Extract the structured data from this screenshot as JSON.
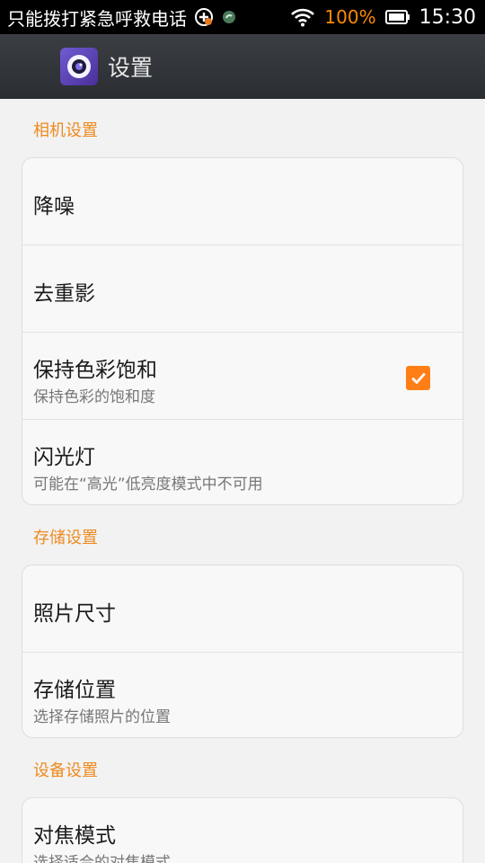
{
  "status_bar": {
    "carrier_text": "只能拨打紧急呼救电话",
    "battery_percent": "100%",
    "time": "15:30",
    "icons": [
      "emergency-plus-icon",
      "app-notification-icon",
      "wifi-icon",
      "battery-icon"
    ]
  },
  "app_bar": {
    "title": "设置",
    "icon": "camera-app-icon"
  },
  "sections": [
    {
      "title": "相机设置",
      "items": [
        {
          "title": "降噪",
          "subtitle": ""
        },
        {
          "title": "去重影",
          "subtitle": ""
        },
        {
          "title": "保持色彩饱和",
          "subtitle": "保持色彩的饱和度",
          "checked": true
        },
        {
          "title": "闪光灯",
          "subtitle": "可能在“高光”低亮度模式中不可用"
        }
      ]
    },
    {
      "title": "存储设置",
      "items": [
        {
          "title": "照片尺寸",
          "subtitle": ""
        },
        {
          "title": "存储位置",
          "subtitle": "选择存储照片的位置"
        }
      ]
    },
    {
      "title": "设备设置",
      "items": [
        {
          "title": "对焦模式",
          "subtitle": "选择适合的对焦模式"
        }
      ]
    }
  ],
  "colors": {
    "accent": "#ee8a1f",
    "checkbox": "#ff7f16",
    "app_bar": "#2f3236",
    "background": "#f2f2f2"
  }
}
